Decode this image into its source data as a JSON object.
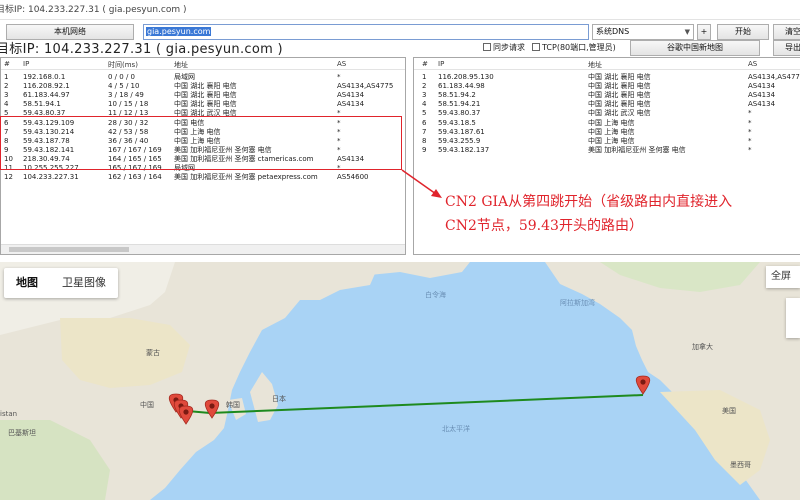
{
  "window": {
    "title": "目标IP: 104.233.227.31 ( gia.pesyun.com )"
  },
  "toolbar": {
    "local_network_label": "本机网络",
    "host_input_value": "gia.pesyun.com",
    "dns_select_value": "系统DNS",
    "plus_label": "+",
    "start_label": "开始",
    "clear_label": "清空"
  },
  "target_line": "目标IP: 104.233.227.31 ( gia.pesyun.com )",
  "options": {
    "sync_request_label": "同步请求",
    "tcp_label": "TCP(80端口,管理员)",
    "google_map_label": "谷歌中国新地图",
    "export_label": "导出"
  },
  "left_table": {
    "columns": [
      "#",
      "IP",
      "时间(ms)",
      "地址",
      "AS"
    ],
    "rows": [
      [
        "1",
        "192.168.0.1",
        "0 / 0 / 0",
        "局域网",
        "*"
      ],
      [
        "2",
        "116.208.92.1",
        "4 / 5 / 10",
        "中国 湖北 襄阳 电信",
        "AS4134,AS4775"
      ],
      [
        "3",
        "61.183.44.97",
        "3 / 18 / 49",
        "中国 湖北 襄阳 电信",
        "AS4134"
      ],
      [
        "4",
        "58.51.94.1",
        "10 / 15 / 18",
        "中国 湖北 襄阳 电信",
        "AS4134"
      ],
      [
        "5",
        "59.43.80.37",
        "11 / 12 / 13",
        "中国 湖北 武汉 电信",
        "*"
      ],
      [
        "6",
        "59.43.129.109",
        "28 / 30 / 32",
        "中国 电信",
        "*"
      ],
      [
        "7",
        "59.43.130.214",
        "42 / 53 / 58",
        "中国 上海 电信",
        "*"
      ],
      [
        "8",
        "59.43.187.78",
        "36 / 36 / 40",
        "中国 上海 电信",
        "*"
      ],
      [
        "9",
        "59.43.182.141",
        "167 / 167 / 169",
        "美国 加利福尼亚州 圣何塞 电信",
        "*"
      ],
      [
        "10",
        "218.30.49.74",
        "164 / 165 / 165",
        "美国 加利福尼亚州 圣何塞 ctamericas.com",
        "AS4134"
      ],
      [
        "11",
        "10.255.255.227",
        "165 / 167 / 169",
        "局域网",
        "*"
      ],
      [
        "12",
        "104.233.227.31",
        "162 / 163 / 164",
        "美国 加利福尼亚州 圣何塞 petaexpress.com",
        "AS54600"
      ]
    ]
  },
  "right_table": {
    "columns": [
      "#",
      "IP",
      "地址",
      "AS"
    ],
    "rows": [
      [
        "1",
        "116.208.95.130",
        "中国 湖北 襄阳 电信",
        "AS4134,AS4775"
      ],
      [
        "2",
        "61.183.44.98",
        "中国 湖北 襄阳 电信",
        "AS4134"
      ],
      [
        "3",
        "58.51.94.2",
        "中国 湖北 襄阳 电信",
        "AS4134"
      ],
      [
        "4",
        "58.51.94.21",
        "中国 湖北 襄阳 电信",
        "AS4134"
      ],
      [
        "5",
        "59.43.80.37",
        "中国 湖北 武汉 电信",
        "*"
      ],
      [
        "6",
        "59.43.18.5",
        "中国 上海 电信",
        "*"
      ],
      [
        "7",
        "59.43.187.61",
        "中国 上海 电信",
        "*"
      ],
      [
        "8",
        "59.43.255.9",
        "中国 上海 电信",
        "*"
      ],
      [
        "9",
        "59.43.182.137",
        "美国 加利福尼亚州 圣何塞 电信",
        "*"
      ]
    ]
  },
  "annotation": {
    "line1": "CN2 GIA从第四跳开始（省级路由内直接进入",
    "line2": "CN2节点，59.43开头的路由）",
    "color": "#e0242c"
  },
  "map": {
    "tabs": [
      "地图",
      "卫星图像"
    ],
    "fullscreen_label": "全屏",
    "labels": [
      {
        "text": "蒙古",
        "kind": "land"
      },
      {
        "text": "中国",
        "kind": "land"
      },
      {
        "text": "韩国",
        "kind": "land"
      },
      {
        "text": "日本",
        "kind": "land"
      },
      {
        "text": "巴基斯坦",
        "kind": "land"
      },
      {
        "text": "istan",
        "kind": "land"
      },
      {
        "text": "北太平洋",
        "kind": "sea"
      },
      {
        "text": "白令海",
        "kind": "sea"
      },
      {
        "text": "阿拉斯加湾",
        "kind": "sea"
      },
      {
        "text": "加拿大",
        "kind": "land"
      },
      {
        "text": "美国",
        "kind": "land"
      },
      {
        "text": "墨西哥",
        "kind": "land"
      }
    ],
    "route_color": "#1e8a1e",
    "marker_color": "#e04a3c"
  }
}
